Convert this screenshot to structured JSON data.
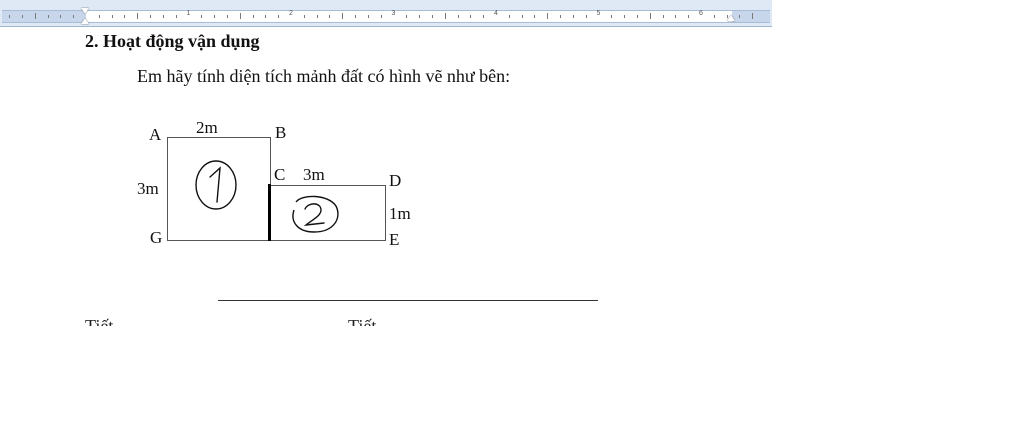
{
  "ruler": {
    "numbers": [
      "1",
      "2",
      "3",
      "4",
      "5",
      "6"
    ]
  },
  "document": {
    "heading": "2. Hoạt động vận dụng",
    "instruction": "Em hãy tính diện  tích mảnh đất có hình vẽ như bên:"
  },
  "figure": {
    "labels": {
      "A": "A",
      "B": "B",
      "C": "C",
      "D": "D",
      "E": "E",
      "G": "G",
      "top_width": "2m",
      "left_height": "3m",
      "cd_width": "3m",
      "de_height": "1m"
    },
    "region_numbers": [
      "1",
      "2"
    ]
  },
  "clipped_line": {
    "left": "Tiết",
    "right": "Tiết"
  }
}
